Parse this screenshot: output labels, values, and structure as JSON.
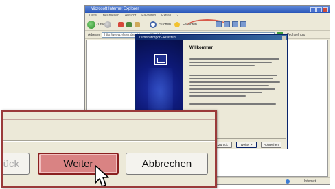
{
  "browser": {
    "title": "Microsoft Internet Explorer",
    "menu": [
      "Datei",
      "Bearbeiten",
      "Ansicht",
      "Favoriten",
      "Extras",
      "?"
    ],
    "toolbar": {
      "back_label": "Zurück",
      "search_label": "Suchen",
      "favorites_label": "Favoriten"
    },
    "address_label": "Adresse",
    "address_value": "http://www.elster.de/elster_zertifikat.htm",
    "links_label": "Wechseln zu",
    "status_zone": "Internet"
  },
  "wizard": {
    "title": "Zertifikatimport-Assistent",
    "heading": "Willkommen",
    "buttons": {
      "back": "< Zurück",
      "next": "Weiter >",
      "cancel": "Abbrechen"
    }
  },
  "zoom": {
    "back_label": "ück",
    "next_label": "Weiter",
    "cancel_label": "Abbrechen"
  },
  "colors": {
    "highlight_border": "#8a2020",
    "highlight_fill": "#d98383",
    "wizard_side": "#0e1a7a"
  }
}
